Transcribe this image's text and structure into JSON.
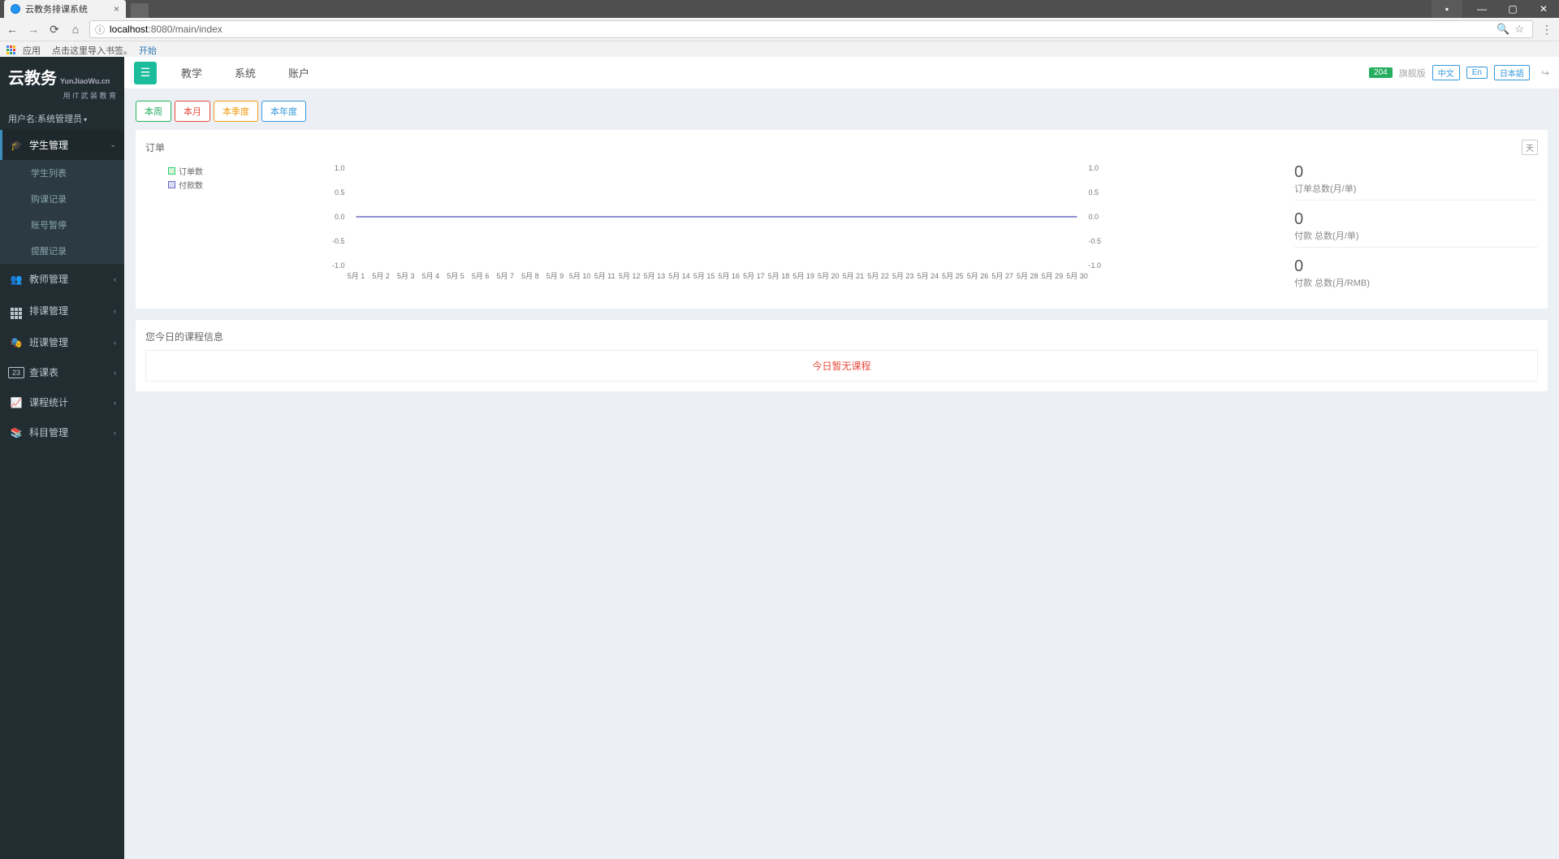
{
  "browser": {
    "tab_title": "云教务排课系统",
    "url_info": "ⓘ",
    "url_host": "localhost",
    "url_port": ":8080",
    "url_path": "/main/index",
    "apps_label": "应用",
    "bookmark_hint": "点击这里导入书签。",
    "bookmark_link": "开始"
  },
  "sidebar": {
    "logo": "云教务",
    "logo_en": "YunJiaoWu.cn",
    "tagline": "用 IT 武 装 教 育",
    "user_label": "用户名:系统管理员",
    "items": [
      {
        "label": "学生管理",
        "icon": "graduation",
        "active": true
      },
      {
        "label": "教师管理",
        "icon": "users"
      },
      {
        "label": "排课管理",
        "icon": "grid"
      },
      {
        "label": "班课管理",
        "icon": "mask"
      },
      {
        "label": "查课表",
        "icon": "calendar"
      },
      {
        "label": "课程统计",
        "icon": "chart"
      },
      {
        "label": "科目管理",
        "icon": "book"
      }
    ],
    "sub_items": [
      "学生列表",
      "购课记录",
      "账号暂停",
      "提醒记录"
    ]
  },
  "topbar": {
    "menu": [
      "教学",
      "系统",
      "账户"
    ],
    "badge": "204",
    "version": "旗舰版",
    "langs": [
      "中文",
      "En",
      "日本語"
    ]
  },
  "range_tabs": [
    "本周",
    "本月",
    "本季度",
    "本年度"
  ],
  "order_panel": {
    "title": "订单",
    "day_btn": "天",
    "legend": [
      "订单数",
      "付款数"
    ],
    "stats": [
      {
        "value": "0",
        "label": "订单总数(月/单)"
      },
      {
        "value": "0",
        "label": "付款 总数(月/单)"
      },
      {
        "value": "0",
        "label": "付款 总数(月/RMB)"
      }
    ]
  },
  "course_panel": {
    "title": "您今日的课程信息",
    "empty": "今日暂无课程"
  },
  "chart_data": {
    "type": "line",
    "title": "订单",
    "ylabel": "",
    "xlabel": "",
    "ylim": [
      -1.0,
      1.0
    ],
    "y_ticks": [
      1.0,
      0.5,
      0.0,
      -0.5,
      -1.0
    ],
    "categories": [
      "5月 1",
      "5月 2",
      "5月 3",
      "5月 4",
      "5月 5",
      "5月 6",
      "5月 7",
      "5月 8",
      "5月 9",
      "5月 10",
      "5月 11",
      "5月 12",
      "5月 13",
      "5月 14",
      "5月 15",
      "5月 16",
      "5月 17",
      "5月 18",
      "5月 19",
      "5月 20",
      "5月 21",
      "5月 22",
      "5月 23",
      "5月 24",
      "5月 25",
      "5月 26",
      "5月 27",
      "5月 28",
      "5月 29",
      "5月 30"
    ],
    "series": [
      {
        "name": "订单数",
        "color": "#2ecc71",
        "values": [
          0,
          0,
          0,
          0,
          0,
          0,
          0,
          0,
          0,
          0,
          0,
          0,
          0,
          0,
          0,
          0,
          0,
          0,
          0,
          0,
          0,
          0,
          0,
          0,
          0,
          0,
          0,
          0,
          0,
          0
        ]
      },
      {
        "name": "付款数",
        "color": "#6a6abf",
        "values": [
          0,
          0,
          0,
          0,
          0,
          0,
          0,
          0,
          0,
          0,
          0,
          0,
          0,
          0,
          0,
          0,
          0,
          0,
          0,
          0,
          0,
          0,
          0,
          0,
          0,
          0,
          0,
          0,
          0,
          0
        ]
      }
    ]
  }
}
